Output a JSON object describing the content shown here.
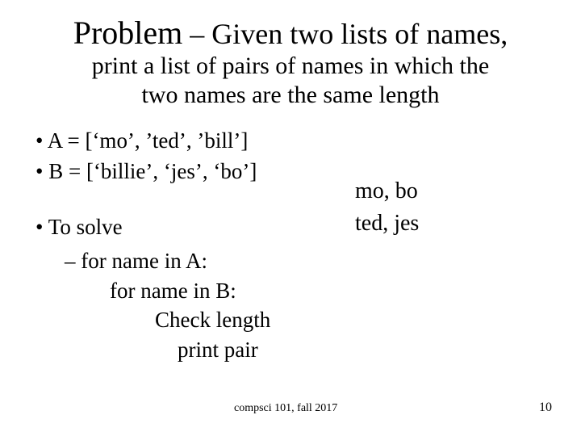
{
  "title": {
    "lead": "Problem",
    "rest1": " – Given two lists of names,",
    "line2": "print a list of pairs of names in which the",
    "line3": "two names are the same length"
  },
  "bullets": {
    "a": "A = [‘mo’, ’ted’, ’bill’]",
    "b": "B = [‘billie’, ‘jes’, ‘bo’]",
    "solve": "To solve"
  },
  "output": {
    "o1": "mo, bo",
    "o2": "ted, jes"
  },
  "sub": {
    "s1": "for name in A:",
    "s2": "for name in B:",
    "s3": "Check length",
    "s4": "print pair"
  },
  "footer": {
    "course": "compsci 101, fall 2017",
    "num": "10"
  }
}
